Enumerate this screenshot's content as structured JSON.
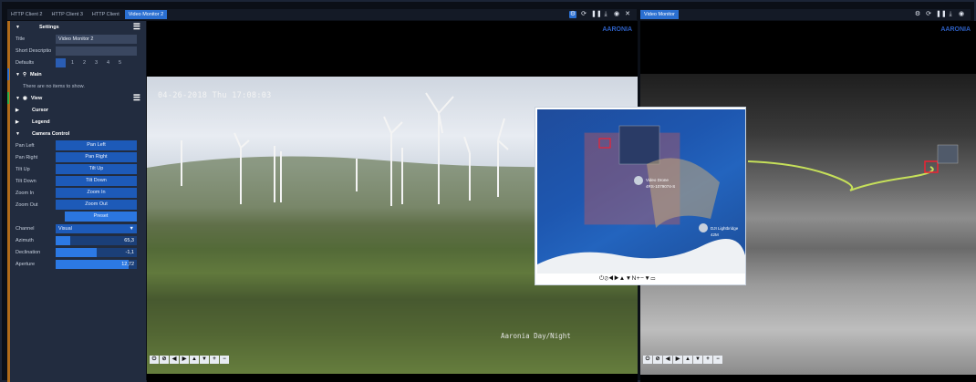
{
  "tabs": [
    {
      "label": "HTTP Client 2",
      "active": false
    },
    {
      "label": "HTTP Client 3",
      "active": false
    },
    {
      "label": "HTTP Client",
      "active": false
    },
    {
      "label": "Video Monitor 2",
      "active": true
    }
  ],
  "right_tab": "Video Monitor",
  "settings": {
    "header": "Settings",
    "title_label": "Title",
    "title_value": "Video Monitor 2",
    "short_desc_label": "Short Descriptio",
    "short_desc_value": "",
    "defaults_label": "Defaults",
    "defaults_numbers": [
      "1",
      "2",
      "3",
      "4",
      "5"
    ]
  },
  "main": {
    "header": "Main",
    "empty_text": "There are no items to show."
  },
  "view": {
    "header": "View",
    "items": [
      "Cursor",
      "Legend",
      "Camera Control"
    ]
  },
  "camera_control": {
    "rows": [
      {
        "label": "Pan Left",
        "button": "Pan Left"
      },
      {
        "label": "Pan Right",
        "button": "Pan Right"
      },
      {
        "label": "Tilt Up",
        "button": "Tilt Up"
      },
      {
        "label": "Tilt Down",
        "button": "Tilt Down"
      },
      {
        "label": "Zoom In",
        "button": "Zoom In"
      },
      {
        "label": "Zoom Out",
        "button": "Zoom Out"
      }
    ],
    "preset_button": "Preset",
    "channel_label": "Channel",
    "channel_value": "Visual",
    "azimuth_label": "Azimuth",
    "azimuth_value": "65,3",
    "azimuth_fraction": 0.18,
    "declination_label": "Declination",
    "declination_value": "-1,1",
    "declination_fraction": 0.5,
    "aperture_label": "Aperture",
    "aperture_value": "12,72",
    "aperture_fraction": 0.9
  },
  "left_video": {
    "timestamp": "04-26-2018 Thu 17:08:03",
    "caption": "Aaronia Day/Night",
    "logo": "AARONIA"
  },
  "right_video": {
    "logo": "AARONIA"
  },
  "overlay": {
    "label1": "Video Drone",
    "label1_sub": "4RS-1079074-S",
    "label2": "DJI Lightbridge",
    "label2_sub": "42M",
    "controls": "⏻⊘◀▶▲▼N+−▼▭"
  },
  "video_controls": [
    "⏻",
    "⊘",
    "◀",
    "▶",
    "▲",
    "▼",
    "+",
    "−"
  ],
  "colors": {
    "accent": "#2a6fd1",
    "sidebar": "#222c3f",
    "button": "#1d5ab8",
    "orange": "#b06b1a"
  }
}
